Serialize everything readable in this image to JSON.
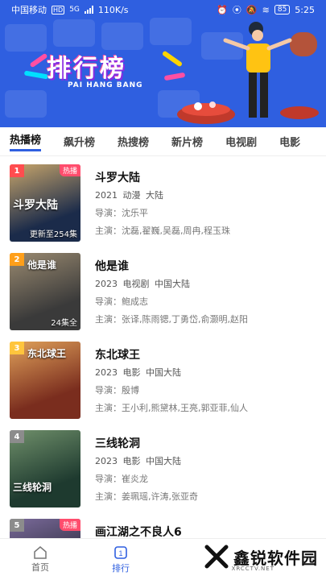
{
  "status_bar": {
    "carrier": "中国移动",
    "hd": "HD",
    "network": "5G",
    "speed": "110K/s",
    "battery": "85",
    "time": "5:25"
  },
  "banner": {
    "title": "排行榜",
    "subtitle": "PAI HANG BANG"
  },
  "tabs": [
    {
      "label": "热播榜",
      "active": true
    },
    {
      "label": "飙升榜"
    },
    {
      "label": "热搜榜"
    },
    {
      "label": "新片榜"
    },
    {
      "label": "电视剧"
    },
    {
      "label": "电影"
    }
  ],
  "items": [
    {
      "rank": "1",
      "rank_color": "#ff4d4f",
      "badge": "热播",
      "poster_text": "斗罗大陆",
      "episodes": "更新至254集",
      "title": "斗罗大陆",
      "meta": "2021  动漫  大陆",
      "director": "导演：沈乐平",
      "cast": "主演：沈磊,翟巍,吴磊,周冉,程玉珠",
      "poster_colors": [
        "#1b2b4a",
        "#c7a56b"
      ]
    },
    {
      "rank": "2",
      "rank_color": "#ff9f1a",
      "badge": "",
      "poster_text": "他是谁",
      "episodes": "24集全",
      "title": "他是谁",
      "meta": "2023  电视剧  中国大陆",
      "director": "导演：鲍成志",
      "cast": "主演：张译,陈雨锶,丁勇岱,俞灏明,赵阳",
      "poster_colors": [
        "#3a3a3a",
        "#9a8a70"
      ]
    },
    {
      "rank": "3",
      "rank_color": "#ffc53d",
      "badge": "",
      "poster_text": "东北球王",
      "episodes": "",
      "title": "东北球王",
      "meta": "2023  电影  中国大陆",
      "director": "导演：殷博",
      "cast": "主演：王小利,熊黛林,王亮,郭亚菲,仙人",
      "poster_colors": [
        "#7a2d1e",
        "#e0a15a"
      ]
    },
    {
      "rank": "4",
      "rank_color": "#8c8c8c",
      "badge": "",
      "poster_text": "三线轮洞",
      "episodes": "",
      "title": "三线轮洞",
      "meta": "2023  电影  中国大陆",
      "director": "导演：崔炎龙",
      "cast": "主演：姜珮瑶,许涛,张亚奇",
      "poster_colors": [
        "#1e3a2f",
        "#6f8f6a"
      ]
    },
    {
      "rank": "5",
      "rank_color": "#8c8c8c",
      "badge": "热播",
      "poster_text": "",
      "episodes": "",
      "title": "画江湖之不良人6",
      "meta": "",
      "director": "",
      "cast": "",
      "poster_colors": [
        "#2a2a3a",
        "#7a6a9a"
      ]
    }
  ],
  "bottom_nav": [
    {
      "label": "首页",
      "icon": "home-icon"
    },
    {
      "label": "排行",
      "icon": "rank-icon",
      "active": true
    }
  ],
  "watermark": {
    "text": "鑫锐软件园",
    "sub": "XRCCTV.NET"
  },
  "colors": {
    "brand": "#2f5fe0",
    "hot_badge": "#ff4d6d"
  }
}
